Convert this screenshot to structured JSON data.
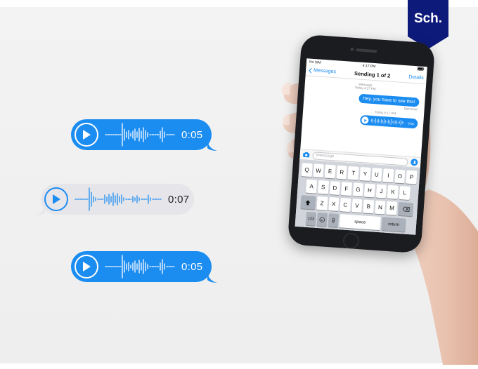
{
  "logo": {
    "text": "Sch.",
    "color": "#0e1a7a"
  },
  "colors": {
    "accent": "#1b8cf0",
    "gray_bubble": "#e6e6ea"
  },
  "bubbles": [
    {
      "duration": "0:05",
      "style": "blue"
    },
    {
      "duration": "0:07",
      "style": "gray"
    },
    {
      "duration": "0:05",
      "style": "blue"
    }
  ],
  "phone": {
    "status": {
      "carrier": "No SIM",
      "time": "4:17 PM",
      "battery": "battery-icon"
    },
    "nav": {
      "back": "Messages",
      "title": "Sending 1 of 2",
      "details": "Details"
    },
    "meta1": {
      "line1": "iMessage",
      "line2": "Today 4:17 PM"
    },
    "sent_message": "Hey, you have to see this!",
    "delivered": "Delivered",
    "meta2": "Today 4:17 PM",
    "audio_duration": "0:05",
    "input_placeholder": "iMessage",
    "keyboard": {
      "row1": [
        "Q",
        "W",
        "E",
        "R",
        "T",
        "Y",
        "U",
        "I",
        "O",
        "P"
      ],
      "row2": [
        "A",
        "S",
        "D",
        "F",
        "G",
        "H",
        "J",
        "K",
        "L"
      ],
      "row3": [
        "Z",
        "X",
        "C",
        "V",
        "B",
        "N",
        "M"
      ],
      "numbers": "123",
      "space": "space",
      "return": "return"
    }
  }
}
